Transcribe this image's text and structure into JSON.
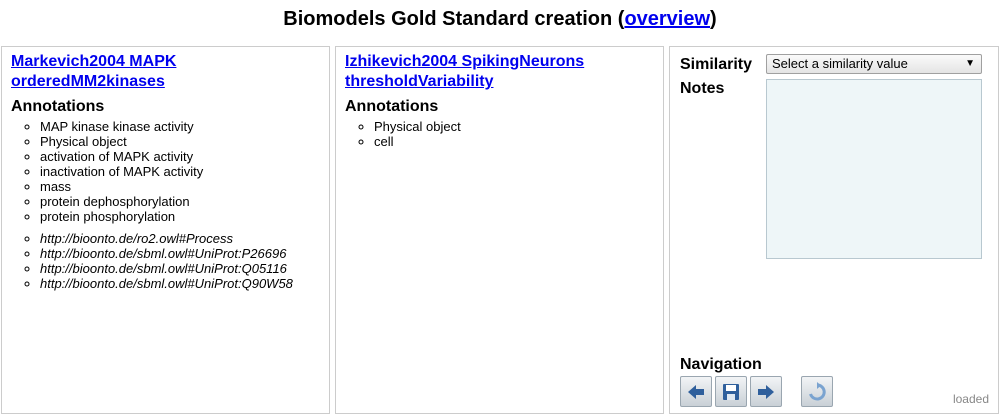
{
  "header": {
    "title_prefix": "Biomodels Gold Standard creation (",
    "title_link": "overview",
    "title_suffix": ")"
  },
  "left": {
    "model_title": "Markevich2004 MAPK orderedMM2kinases",
    "annotations_heading": "Annotations",
    "terms": [
      "MAP kinase kinase activity",
      "Physical object",
      "activation of MAPK activity",
      "inactivation of MAPK activity",
      "mass",
      "protein dephosphorylation",
      "protein phosphorylation"
    ],
    "uris": [
      "http://bioonto.de/ro2.owl#Process",
      "http://bioonto.de/sbml.owl#UniProt:P26696",
      "http://bioonto.de/sbml.owl#UniProt:Q05116",
      "http://bioonto.de/sbml.owl#UniProt:Q90W58"
    ]
  },
  "middle": {
    "model_title": "Izhikevich2004 SpikingNeurons thresholdVariability",
    "annotations_heading": "Annotations",
    "terms": [
      "Physical object",
      "cell"
    ]
  },
  "right": {
    "similarity_label": "Similarity",
    "similarity_select": "Select a similarity value",
    "notes_label": "Notes",
    "notes_value": "",
    "navigation_label": "Navigation",
    "status": "loaded"
  },
  "colors": {
    "link": "#0000ee",
    "notes_bg": "#eef6f8",
    "nav_icon": "#3a6fb0"
  }
}
